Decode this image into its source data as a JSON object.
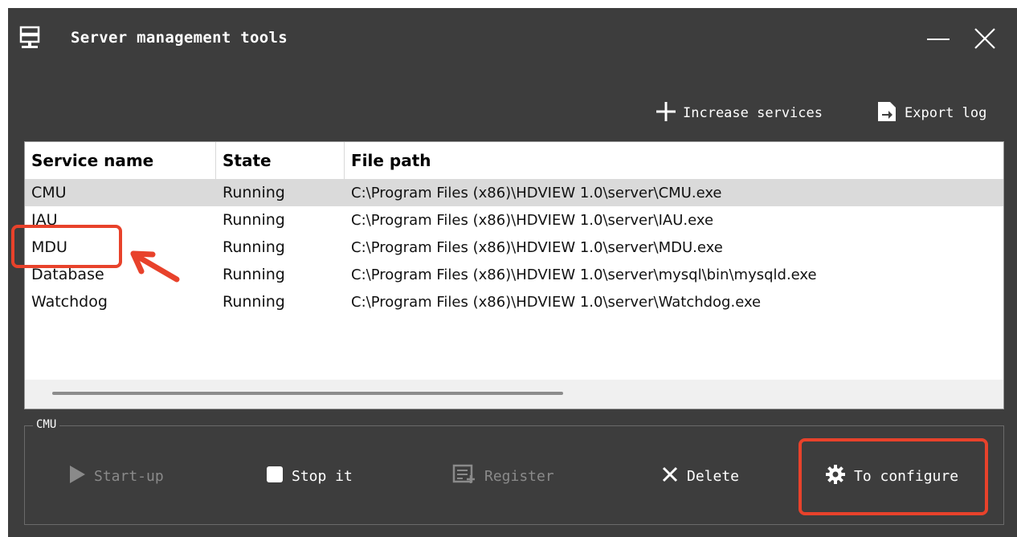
{
  "window": {
    "title": "Server management tools",
    "icons": {
      "app": "server-icon",
      "minimize": "minimize-icon",
      "close": "close-icon"
    }
  },
  "toolbar": {
    "add_label": "Increase services",
    "export_label": "Export log"
  },
  "table": {
    "headers": {
      "name": "Service name",
      "state": "State",
      "path": "File path"
    },
    "rows": [
      {
        "name": "CMU",
        "state": "Running",
        "path": "C:\\Program Files (x86)\\HDVIEW 1.0\\server\\CMU.exe"
      },
      {
        "name": "IAU",
        "state": "Running",
        "path": "C:\\Program Files (x86)\\HDVIEW 1.0\\server\\IAU.exe"
      },
      {
        "name": "MDU",
        "state": "Running",
        "path": "C:\\Program Files (x86)\\HDVIEW 1.0\\server\\MDU.exe"
      },
      {
        "name": "Database",
        "state": "Running",
        "path": "C:\\Program Files (x86)\\HDVIEW 1.0\\server\\mysql\\bin\\mysqld.exe"
      },
      {
        "name": "Watchdog",
        "state": "Running",
        "path": "C:\\Program Files (x86)\\HDVIEW 1.0\\server\\Watchdog.exe"
      }
    ],
    "selected_row": 0
  },
  "group": {
    "label": "CMU",
    "actions": {
      "start": "Start-up",
      "stop": "Stop it",
      "register": "Register",
      "delete": "Delete",
      "configure": "To configure"
    }
  },
  "colors": {
    "window_bg": "#3d3d3d",
    "annotation": "#e8422b",
    "disabled_text": "#8a8a8a",
    "selected_row": "#dadada"
  }
}
